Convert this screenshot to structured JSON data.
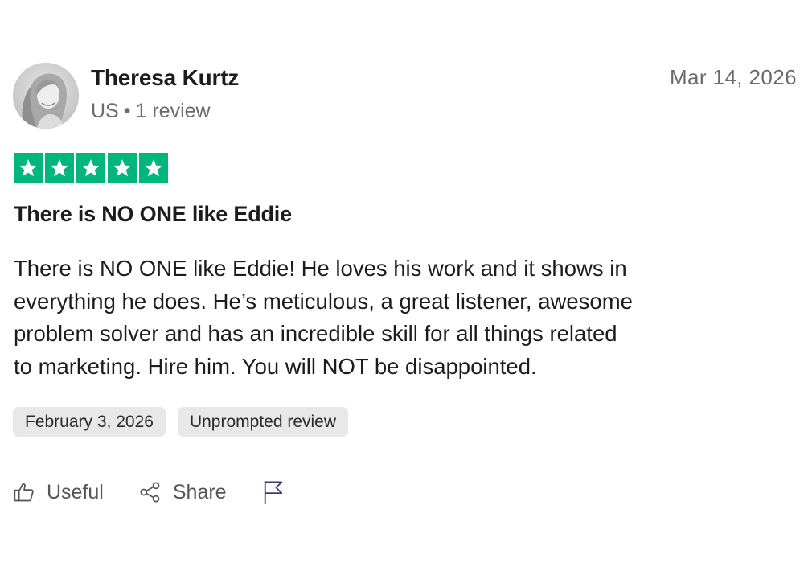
{
  "review": {
    "reviewer": {
      "name": "Theresa Kurtz",
      "country": "US",
      "separator": "•",
      "review_count": "1 review"
    },
    "date": "Mar 14, 2026",
    "rating": 5,
    "rating_max": 5,
    "star_color": "#00b67a",
    "title": "There is NO ONE like Eddie",
    "body_lines": [
      "There is NO ONE like Eddie! He loves his work and it shows in",
      "everything he does. He’s meticulous, a great listener, awesome",
      "problem solver and has an incredible skill for all things related",
      "to marketing. Hire him. You will NOT be disappointed."
    ],
    "tags": [
      "February 3, 2026",
      "Unprompted review"
    ],
    "actions": {
      "useful_label": "Useful",
      "useful_icon": "thumbs-up-icon",
      "share_label": "Share",
      "share_icon": "share-icon",
      "report_icon": "flag-icon"
    }
  }
}
